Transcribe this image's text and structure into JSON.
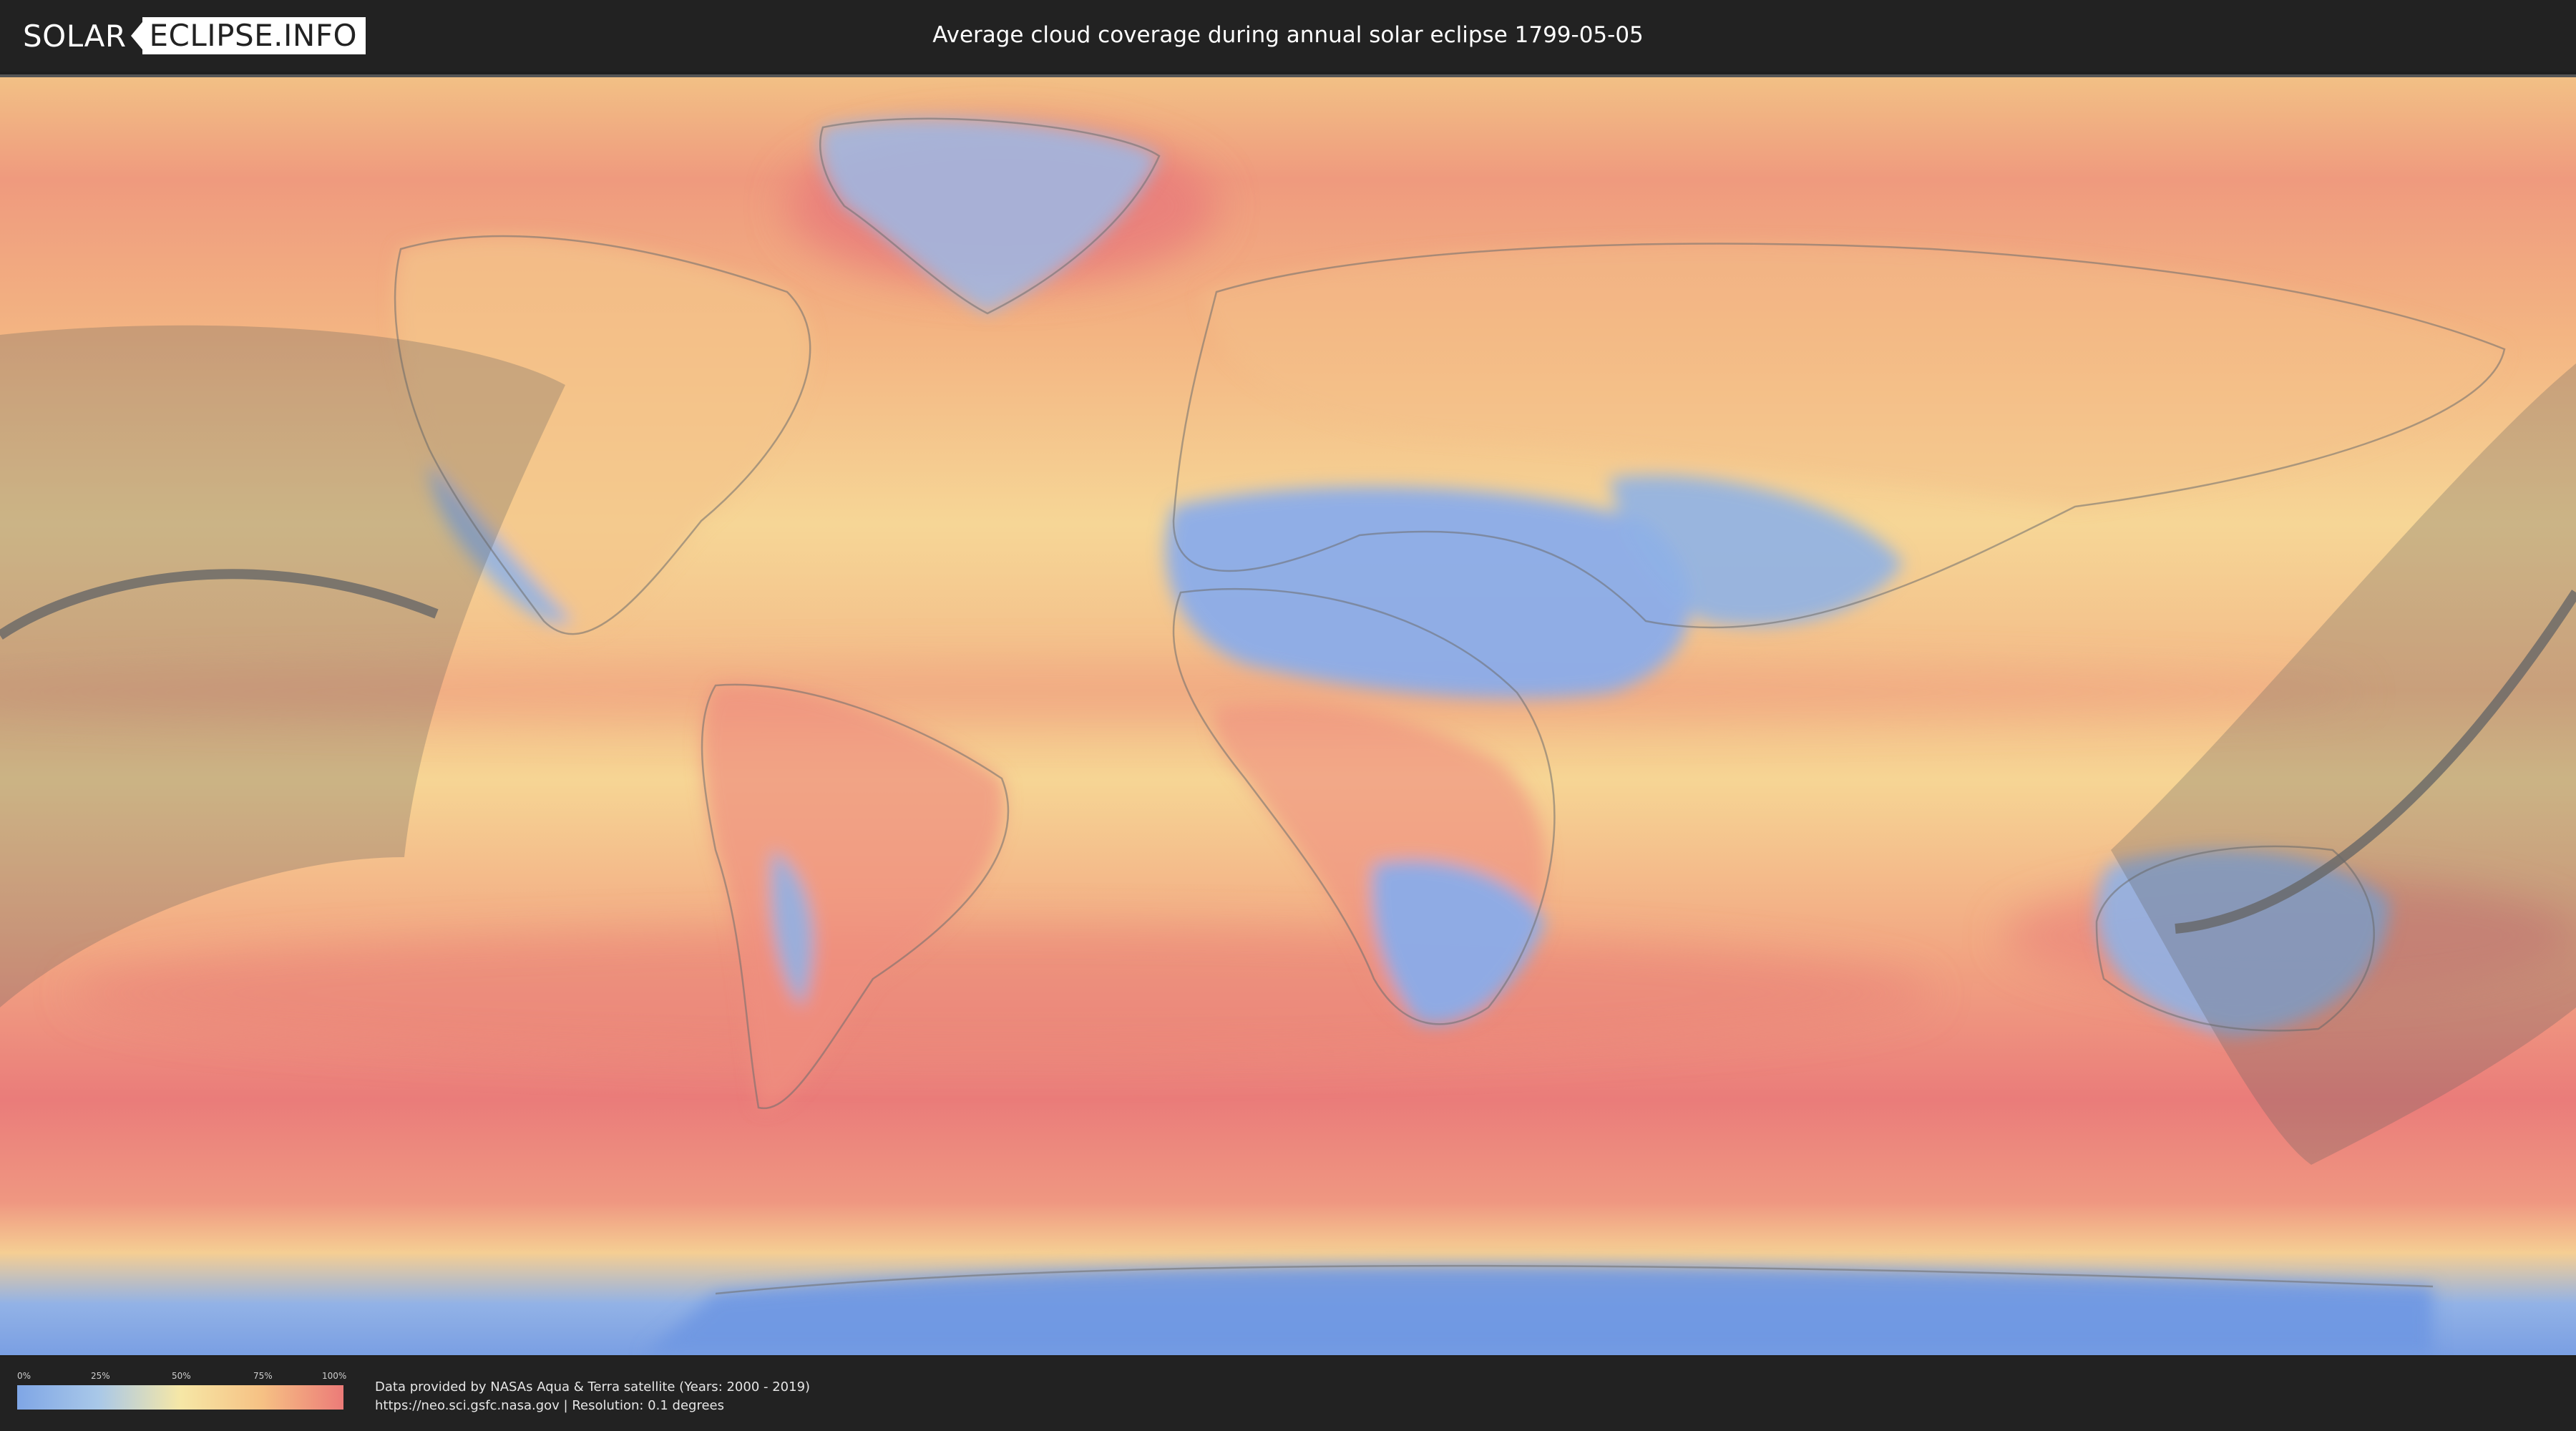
{
  "header": {
    "logo_left": "SOLAR",
    "logo_right": "ECLIPSE.INFO",
    "title": "Average cloud coverage during annual solar eclipse 1799-05-05"
  },
  "legend": {
    "ticks": [
      "0%",
      "25%",
      "50%",
      "75%",
      "100%"
    ],
    "gradient_colors": [
      "#7fa6e6",
      "#a9c8e8",
      "#f6e7a6",
      "#f6c184",
      "#ec7b78"
    ]
  },
  "footer": {
    "credit_line1": "Data provided by NASAs Aqua & Terra satellite (Years: 2000 - 2019)",
    "credit_line2": "https://neo.sci.gsfc.nasa.gov | Resolution: 0.1 degrees"
  },
  "icons": {
    "logo_mark": "eclipse-mark-icon"
  }
}
